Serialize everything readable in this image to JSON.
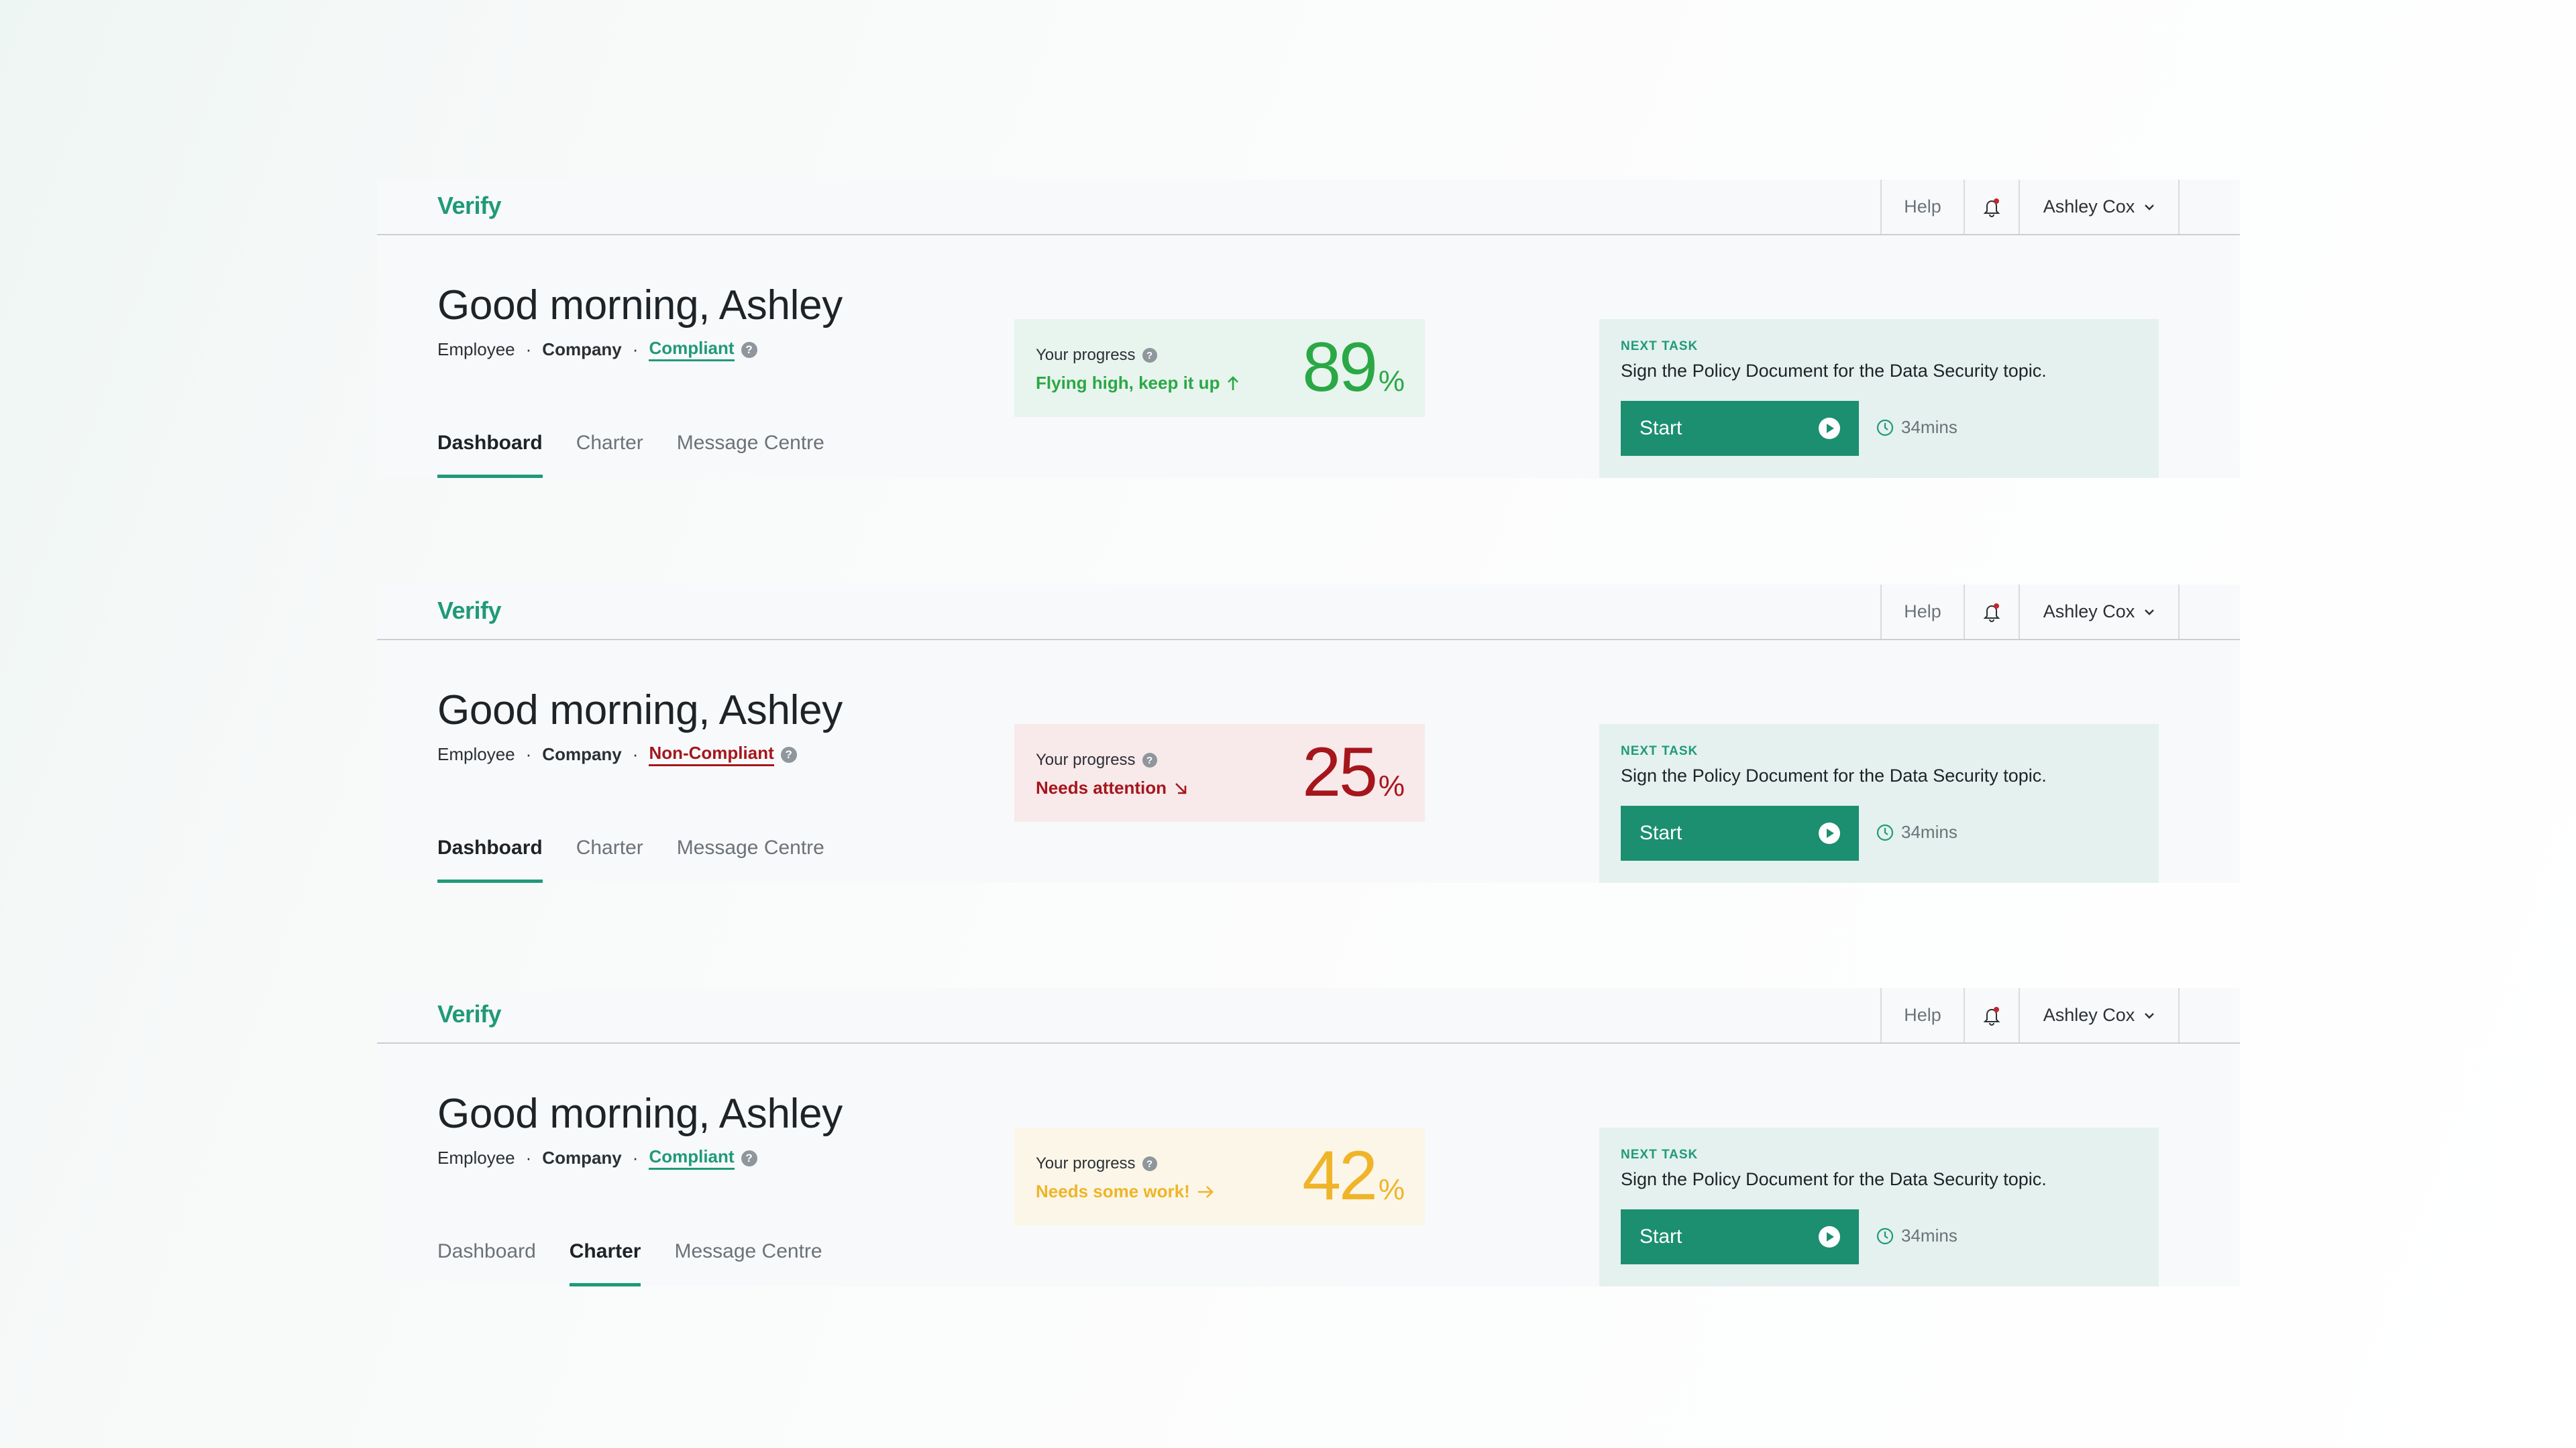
{
  "colors": {
    "brand": "#1f9a78",
    "compliant": "#1f9a78",
    "noncompliant": "#a5161c",
    "good": "#2aa845",
    "bad": "#a5161c",
    "warn": "#f0b429",
    "good_bg": "#e8f4ee",
    "bad_bg": "#f8e9ea",
    "warn_bg": "#fbf6e8"
  },
  "panels": [
    {
      "logo": "Verify",
      "nav": {
        "help": "Help",
        "user": "Ashley Cox"
      },
      "greeting": "Good morning, Ashley",
      "role": "Employee",
      "company": "Company",
      "status": "Compliant",
      "status_type": "compliant",
      "tabs": [
        "Dashboard",
        "Charter",
        "Message Centre"
      ],
      "active_tab": 0,
      "progress": {
        "label": "Your progress",
        "message": "Flying high, keep it up",
        "icon": "arrow-up-icon",
        "value": "89",
        "unit": "%",
        "tone": "good"
      },
      "task": {
        "caption": "NEXT TASK",
        "description": "Sign the Policy Document for the Data Security topic.",
        "button": "Start",
        "duration": "34mins"
      }
    },
    {
      "logo": "Verify",
      "nav": {
        "help": "Help",
        "user": "Ashley Cox"
      },
      "greeting": "Good morning, Ashley",
      "role": "Employee",
      "company": "Company",
      "status": "Non-Compliant",
      "status_type": "noncompliant",
      "tabs": [
        "Dashboard",
        "Charter",
        "Message Centre"
      ],
      "active_tab": 0,
      "progress": {
        "label": "Your progress",
        "message": "Needs attention",
        "icon": "arrow-down-right-icon",
        "value": "25",
        "unit": "%",
        "tone": "bad"
      },
      "task": {
        "caption": "NEXT TASK",
        "description": "Sign the Policy Document for the Data Security topic.",
        "button": "Start",
        "duration": "34mins"
      }
    },
    {
      "logo": "Verify",
      "nav": {
        "help": "Help",
        "user": "Ashley Cox"
      },
      "greeting": "Good morning, Ashley",
      "role": "Employee",
      "company": "Company",
      "status": "Compliant",
      "status_type": "compliant",
      "tabs": [
        "Dashboard",
        "Charter",
        "Message Centre"
      ],
      "active_tab": 1,
      "progress": {
        "label": "Your progress",
        "message": "Needs some work!",
        "icon": "arrow-right-icon",
        "value": "42",
        "unit": "%",
        "tone": "warn"
      },
      "task": {
        "caption": "NEXT TASK",
        "description": "Sign the Policy Document for the Data Security topic.",
        "button": "Start",
        "duration": "34mins"
      }
    }
  ]
}
